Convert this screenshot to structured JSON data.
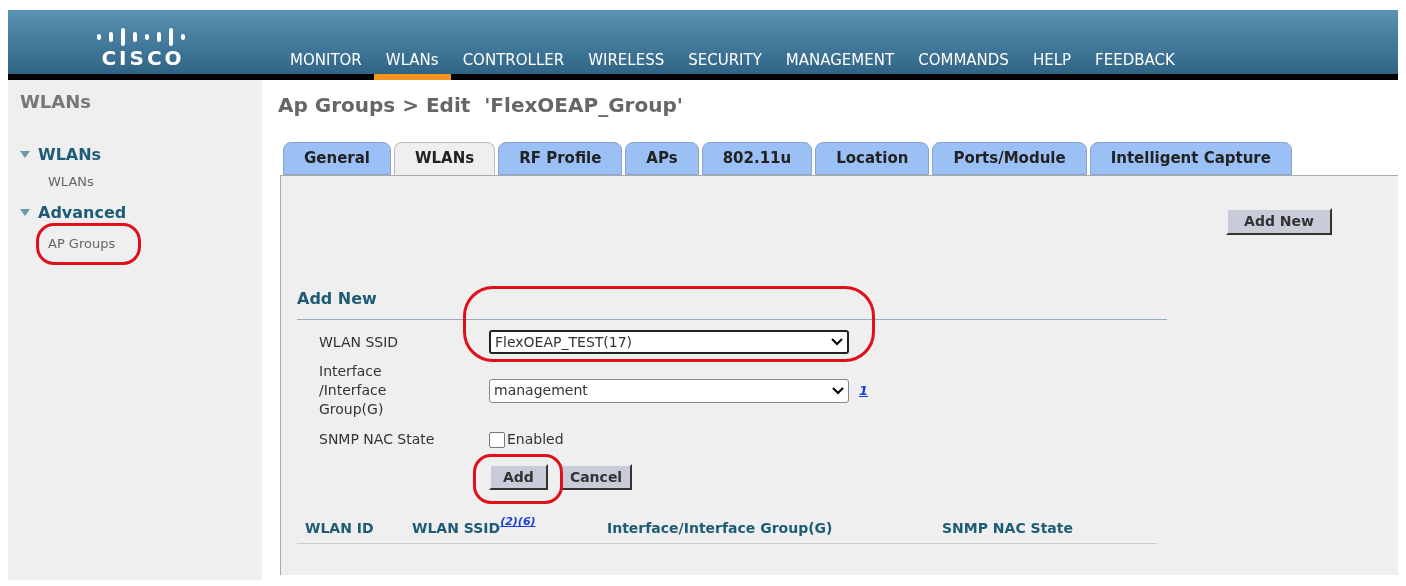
{
  "header": {
    "logo": "CISCO",
    "nav": [
      {
        "label": "MONITOR",
        "selected": false
      },
      {
        "label": "WLANs",
        "selected": true
      },
      {
        "label": "CONTROLLER",
        "selected": false
      },
      {
        "label": "WIRELESS",
        "selected": false
      },
      {
        "label": "SECURITY",
        "selected": false
      },
      {
        "label": "MANAGEMENT",
        "selected": false
      },
      {
        "label": "COMMANDS",
        "selected": false
      },
      {
        "label": "HELP",
        "selected": false
      },
      {
        "label": "FEEDBACK",
        "selected": false
      }
    ]
  },
  "sidebar": {
    "title": "WLANs",
    "sections": [
      {
        "label": "WLANs",
        "expanded": true,
        "children": [
          {
            "label": "WLANs",
            "highlighted": false
          }
        ]
      },
      {
        "label": "Advanced",
        "expanded": true,
        "children": [
          {
            "label": "AP Groups",
            "highlighted": true
          }
        ]
      }
    ]
  },
  "page_title": "Ap Groups > Edit  'FlexOEAP_Group'",
  "tabs": [
    {
      "label": "General",
      "selected": false
    },
    {
      "label": "WLANs",
      "selected": true
    },
    {
      "label": "RF Profile",
      "selected": false
    },
    {
      "label": "APs",
      "selected": false
    },
    {
      "label": "802.11u",
      "selected": false
    },
    {
      "label": "Location",
      "selected": false
    },
    {
      "label": "Ports/Module",
      "selected": false
    },
    {
      "label": "Intelligent Capture",
      "selected": false
    }
  ],
  "add_new_button": "Add New",
  "form": {
    "heading": "Add New",
    "wlan_ssid": {
      "label": "WLAN SSID",
      "value": "FlexOEAP_TEST(17)",
      "highlighted": true
    },
    "interface": {
      "label_lines": [
        "Interface",
        "/Interface",
        "Group(G)"
      ],
      "value": "management",
      "footnote": "1"
    },
    "snmp_nac": {
      "label": "SNMP NAC State",
      "option": "Enabled",
      "checked": false
    },
    "add": {
      "label": "Add",
      "highlighted": true
    },
    "cancel": "Cancel"
  },
  "table": {
    "columns": [
      {
        "label": "WLAN ID"
      },
      {
        "label": "WLAN SSID",
        "footnotes": "(2)(6)"
      },
      {
        "label": "Interface/Interface Group(G)"
      },
      {
        "label": "SNMP NAC State"
      }
    ]
  }
}
